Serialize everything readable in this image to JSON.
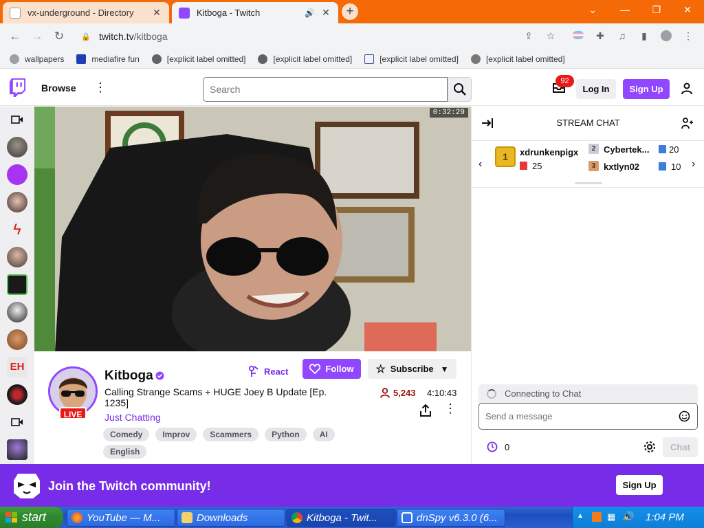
{
  "browser": {
    "tabs": [
      {
        "title": "vx-underground - Directory",
        "active": false
      },
      {
        "title": "Kitboga - Twitch",
        "active": true,
        "audio": true
      }
    ],
    "url_host": "twitch.tv",
    "url_path": "/kitboga",
    "bookmarks": [
      {
        "label": "wallpapers"
      },
      {
        "label": "mediafire fun"
      },
      {
        "label": "[explicit label omitted]"
      },
      {
        "label": "[explicit label omitted]"
      },
      {
        "label": "[explicit label omitted]"
      },
      {
        "label": "[explicit label omitted]"
      }
    ]
  },
  "twitch": {
    "nav": {
      "browse": "Browse",
      "search_placeholder": "Search",
      "inbox_count": "92",
      "login": "Log In",
      "signup": "Sign Up"
    },
    "video": {
      "timestamp": "0:32:29"
    },
    "channel": {
      "name": "Kitboga",
      "live": "LIVE",
      "title": "Calling Strange Scams + HUGE Joey B Update [Ep. 1235]",
      "category": "Just Chatting",
      "tags": [
        "Comedy",
        "Improv",
        "Scammers",
        "Python",
        "AI",
        "English"
      ],
      "react": "React",
      "follow": "Follow",
      "subscribe": "Subscribe",
      "viewers": "5,243",
      "uptime": "4:10:43"
    },
    "chat": {
      "header": "STREAM CHAT",
      "gifters": [
        {
          "rank": "1",
          "user": "xdrunkenpigx",
          "count": "25"
        },
        {
          "rank": "2",
          "user": "Cybertek...",
          "count": "20"
        },
        {
          "rank": "3",
          "user": "kxtlyn02",
          "count": "10"
        }
      ],
      "connecting": "Connecting to Chat",
      "input_placeholder": "Send a message",
      "points": "0",
      "chat_button": "Chat"
    },
    "banner": {
      "text": "Join the Twitch community!",
      "signup": "Sign Up"
    }
  },
  "taskbar": {
    "start": "start",
    "tasks": [
      {
        "label": "YouTube — M..."
      },
      {
        "label": "Downloads"
      },
      {
        "label": "Kitboga - Twit..."
      },
      {
        "label": "dnSpy v6.3.0 (6..."
      }
    ],
    "clock": "1:04 PM"
  },
  "colors": {
    "twitch_purple": "#9147ff",
    "banner_purple": "#772ce8",
    "live_red": "#e91916",
    "browser_frame": "#f56a06"
  }
}
